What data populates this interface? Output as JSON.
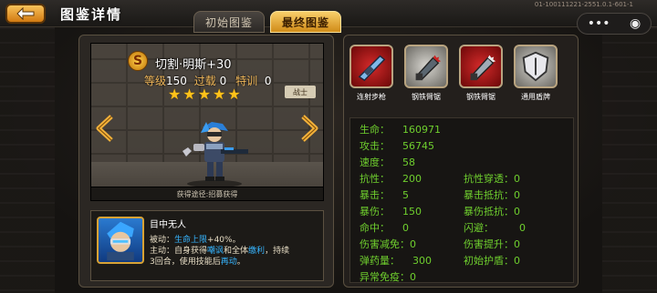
{
  "header": {
    "title": "图鉴详情",
    "version": "01-100111221-2551.0.1-601-1"
  },
  "tabs": [
    {
      "label": "初始图鉴",
      "active": false
    },
    {
      "label": "最终图鉴",
      "active": true
    }
  ],
  "hero": {
    "rank_badge": "S",
    "name": "切割·明斯+30",
    "level_label": "等级",
    "level": "150",
    "overload_label": "过载",
    "overload": "0",
    "training_label": "特训",
    "training": "0",
    "stars": 5,
    "tag": "战士",
    "obtain_text": "获得途径:招募获得"
  },
  "skill": {
    "title": "目中无人",
    "line1_prefix": "被动：",
    "line1_hl": "生命上限",
    "line1_suffix": "+40%。",
    "line2_prefix": "主动：自身获得",
    "line2_hl1": "嘲讽",
    "line2_mid": "和全体",
    "line2_hl2": "缴利",
    "line2_suffix": "，持续",
    "line3_prefix": "3回合，使用技能后",
    "line3_hl": "再动",
    "line3_suffix": "。"
  },
  "equipment": [
    {
      "label": "连射步枪",
      "icon": "rifle-icon",
      "style": "red"
    },
    {
      "label": "钢铁臂锯",
      "icon": "chainsaw-icon",
      "style": "gray"
    },
    {
      "label": "钢铁臂锯",
      "icon": "chainsaw-icon",
      "style": "red"
    },
    {
      "label": "通用盾牌",
      "icon": "shield-icon",
      "style": "gray"
    }
  ],
  "attributes": [
    {
      "key": "生命：",
      "value": "160971"
    },
    {
      "key": "攻击：",
      "value": "56745"
    },
    {
      "key": "速度：",
      "value": "58"
    },
    {
      "key": "抗性：",
      "value": "200"
    },
    {
      "key": "抗性穿透：",
      "value": "0"
    },
    {
      "key": "暴击：",
      "value": "5"
    },
    {
      "key": "暴击抵抗：",
      "value": "0"
    },
    {
      "key": "暴伤：",
      "value": "150"
    },
    {
      "key": "暴伤抵抗：",
      "value": "0"
    },
    {
      "key": "命中：",
      "value": "0"
    },
    {
      "key": "闪避：",
      "value": "0"
    },
    {
      "key": "伤害减免：",
      "value": "0"
    },
    {
      "key": "伤害提升：",
      "value": "0"
    },
    {
      "key": "弹药量：",
      "value": "300"
    },
    {
      "key": "初始护盾：",
      "value": "0"
    },
    {
      "key": "异常免疫：",
      "value": "0"
    }
  ],
  "colors": {
    "accent": "#f7b43a",
    "attr_green": "#6fcf2e",
    "skill_blue": "#36b5ff"
  }
}
